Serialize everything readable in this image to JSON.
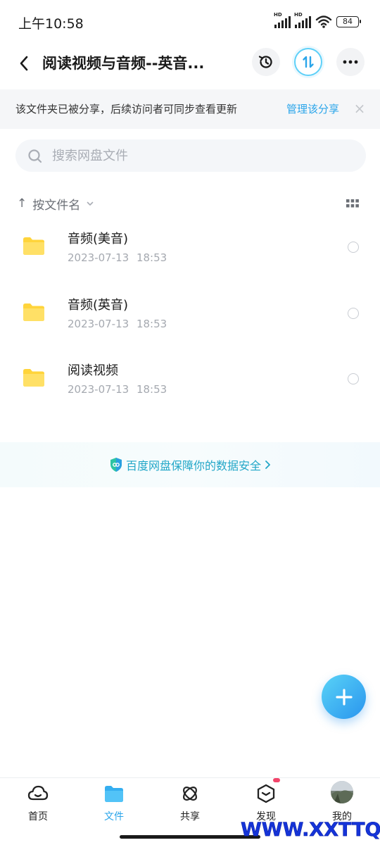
{
  "status_bar": {
    "time": "上午10:58",
    "signal_label_1": "HD",
    "signal_label_2": "HD",
    "battery": "84"
  },
  "header": {
    "title": "阅读视频与音频--英音..."
  },
  "share_notice": {
    "text": "该文件夹已被分享，后续访问者可同步查看更新",
    "manage_label": "管理该分享",
    "close_glyph": "×"
  },
  "search": {
    "placeholder": "搜索网盘文件"
  },
  "sort": {
    "arrow": "↑",
    "label": "按文件名"
  },
  "files": [
    {
      "name": "音频(美音)",
      "date": "2023-07-13 18:53"
    },
    {
      "name": "音频(英音)",
      "date": "2023-07-13 18:53"
    },
    {
      "name": "阅读视频",
      "date": "2023-07-13 18:53"
    }
  ],
  "security_banner": {
    "text": "百度网盘保障你的数据安全"
  },
  "bottom_nav": [
    {
      "label": "首页",
      "icon": "cloud-home-icon"
    },
    {
      "label": "文件",
      "icon": "folder-icon"
    },
    {
      "label": "共享",
      "icon": "share-atom-icon"
    },
    {
      "label": "发现",
      "icon": "discover-cube-icon"
    },
    {
      "label": "我的",
      "icon": "avatar"
    }
  ],
  "watermark": "WWW.XXTTQ.COM",
  "colors": {
    "accent": "#2aa5ea",
    "folder": "#ffd43b",
    "badge": "#f2456a"
  }
}
